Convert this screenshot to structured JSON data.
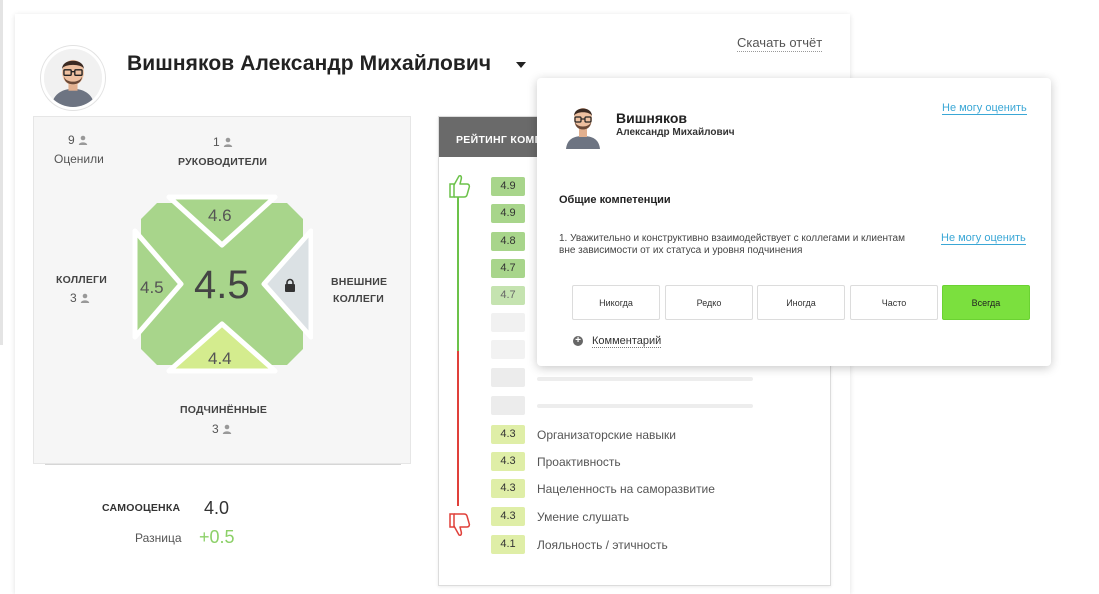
{
  "header": {
    "name": "Вишняков Александр Михайлович",
    "download_label": "Скачать отчёт"
  },
  "score_panel": {
    "raters_count": "9",
    "raters_label": "Оценили",
    "managers_count": "1",
    "managers_label": "РУКОВОДИТЕЛИ",
    "colleagues_label": "КОЛЛЕГИ",
    "colleagues_count": "3",
    "external_label_line1": "ВНЕШНИЕ",
    "external_label_line2": "КОЛЛЕГИ",
    "subordinates_label": "ПОДЧИНЁННЫЕ",
    "subordinates_count": "3",
    "overall_score": "4.5",
    "managers_score": "4.6",
    "colleagues_score": "4.5",
    "subordinates_score": "4.4",
    "self_label": "САМООЦЕНКА",
    "self_score": "4.0",
    "diff_label": "Разница",
    "diff_value": "+0.5"
  },
  "rating": {
    "header": "РЕЙТИНГ КОМПЕТЕНЦИЙ",
    "top_badges": [
      "4.9",
      "4.9",
      "4.8",
      "4.7",
      "4.7"
    ],
    "bottom_items": [
      {
        "score": "4.3",
        "label": "Организаторские навыки"
      },
      {
        "score": "4.3",
        "label": "Проактивность"
      },
      {
        "score": "4.3",
        "label": "Нацеленность на саморазвитие"
      },
      {
        "score": "4.3",
        "label": "Умение слушать"
      },
      {
        "score": "4.1",
        "label": "Лояльность / этичность"
      }
    ]
  },
  "popup": {
    "last_name": "Вишняков",
    "first_names": "Александр Михайлович",
    "cant_rate": "Не могу оценить",
    "section_title": "Общие компетенции",
    "question": "1. Уважительно и конструктивно взаимодействует с коллегами и клиентам вне зависимости от их статуса и уровня подчинения",
    "options": [
      "Никогда",
      "Редко",
      "Иногда",
      "Часто",
      "Всегда"
    ],
    "selected_option": "Всегда",
    "comment_label": "Комментарий"
  },
  "colors": {
    "green_light": "#a8d58b",
    "green_pale": "#d4ec8e",
    "grey_sector": "#dbe1e4",
    "accent_link": "#3aa7d6",
    "selected_option": "#7be03e",
    "rating_header": "#6a6a6a"
  },
  "icons": [
    "person-icon",
    "lock-icon",
    "thumbs-up-icon",
    "thumbs-down-icon",
    "plus-circle-icon",
    "chevron-down-icon"
  ]
}
